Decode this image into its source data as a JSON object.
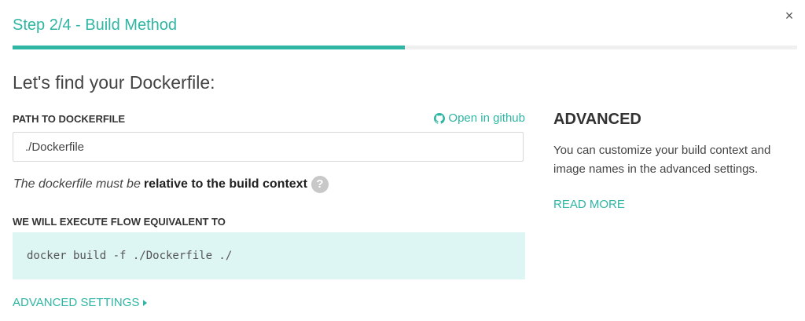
{
  "header": {
    "title": "Step 2/4 - Build Method",
    "close_symbol": "×",
    "progress": 0.5,
    "accent_color": "#2fb5a3"
  },
  "main": {
    "heading": "Let's find your Dockerfile:",
    "path_label": "PATH TO DOCKERFILE",
    "github_link": "Open in github",
    "github_icon": "github-icon",
    "path_value": "./Dockerfile",
    "hint_italic": "The dockerfile must be",
    "hint_bold": "relative to the build context",
    "help_symbol": "?",
    "exec_label": "WE WILL EXECUTE FLOW EQUIVALENT TO",
    "command": "docker build -f ./Dockerfile ./",
    "advanced_settings": "ADVANCED SETTINGS"
  },
  "advanced": {
    "heading": "ADVANCED",
    "description": "You can customize your build context and image names in the advanced settings.",
    "read_more": "READ MORE"
  }
}
